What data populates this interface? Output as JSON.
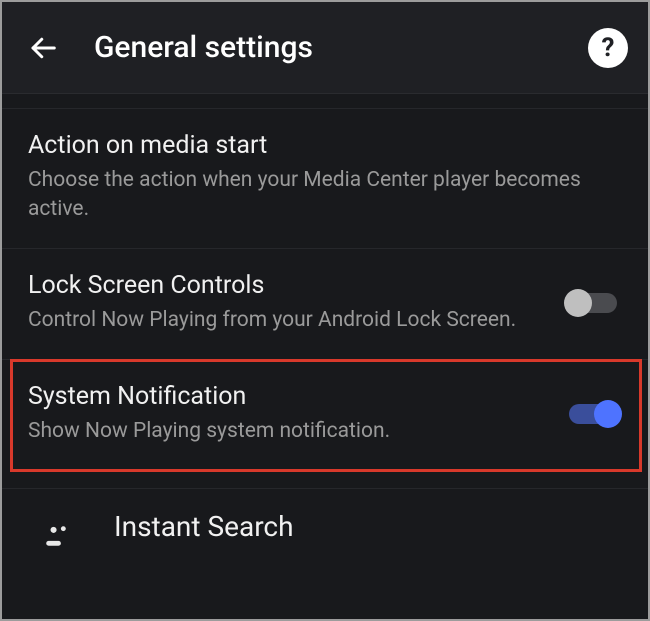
{
  "header": {
    "title": "General settings"
  },
  "items": [
    {
      "title": "Action on media start",
      "desc": "Choose the action when your Media Center player becomes active.",
      "hasToggle": false
    },
    {
      "title": "Lock Screen Controls",
      "desc": "Control Now Playing from your Android Lock Screen.",
      "hasToggle": true,
      "toggle": false
    },
    {
      "title": "System Notification",
      "desc": "Show Now Playing system notification.",
      "hasToggle": true,
      "toggle": true,
      "highlighted": true
    }
  ],
  "instant": {
    "title": "Instant Search"
  }
}
